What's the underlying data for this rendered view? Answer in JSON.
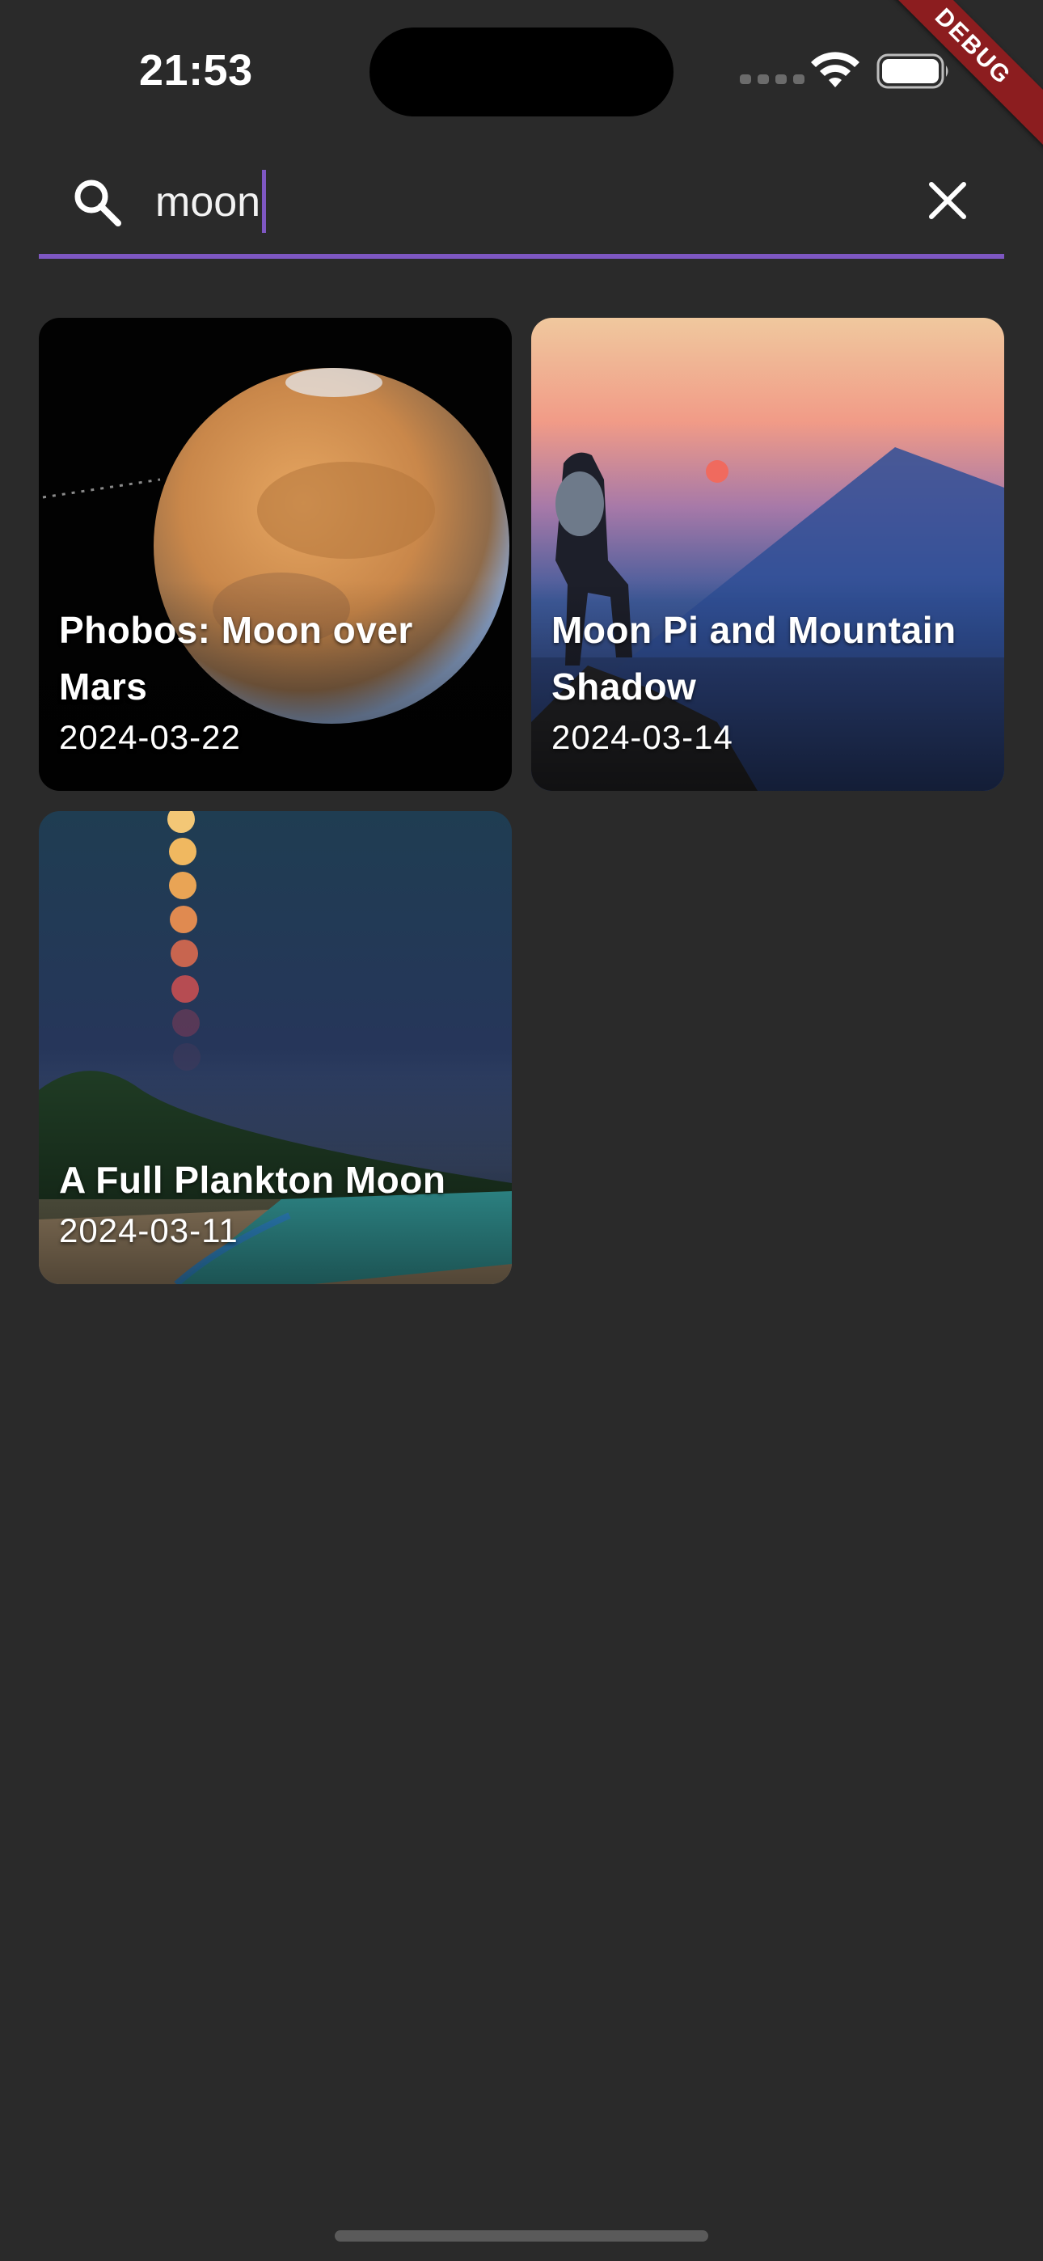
{
  "status_bar": {
    "time": "21:53",
    "debug_label": "DEBUG"
  },
  "search": {
    "value": "moon",
    "icon": "search-icon",
    "clear_icon": "close-icon",
    "accent_color": "#7e57c2"
  },
  "results": [
    {
      "title": "Phobos: Moon over Mars",
      "date": "2024-03-22"
    },
    {
      "title": "Moon Pi and Mountain Shadow",
      "date": "2024-03-14"
    },
    {
      "title": "A Full Plankton Moon",
      "date": "2024-03-11"
    }
  ],
  "colors": {
    "background": "#2a2a2a",
    "debug_ribbon": "#8c1d1f"
  }
}
